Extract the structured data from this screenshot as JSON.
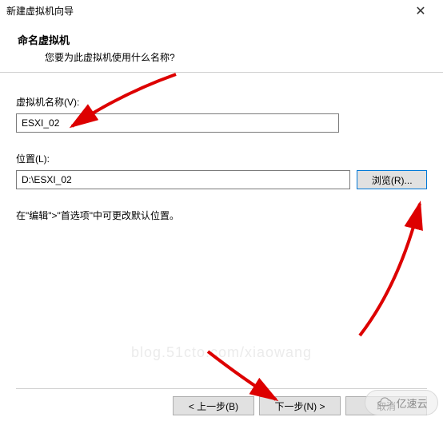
{
  "window": {
    "title": "新建虚拟机向导"
  },
  "header": {
    "title": "命名虚拟机",
    "subtitle": "您要为此虚拟机使用什么名称?"
  },
  "fields": {
    "name_label": "虚拟机名称(V):",
    "name_value": "ESXI_02",
    "location_label": "位置(L):",
    "location_value": "D:\\ESXI_02",
    "browse_label": "浏览(R)..."
  },
  "hint": "在\"编辑\">\"首选项\"中可更改默认位置。",
  "footer": {
    "back": "< 上一步(B)",
    "next": "下一步(N) >",
    "cancel": "取消"
  },
  "badge": {
    "text": "亿速云"
  },
  "watermark": "blog.51cto.com/xiaowang"
}
